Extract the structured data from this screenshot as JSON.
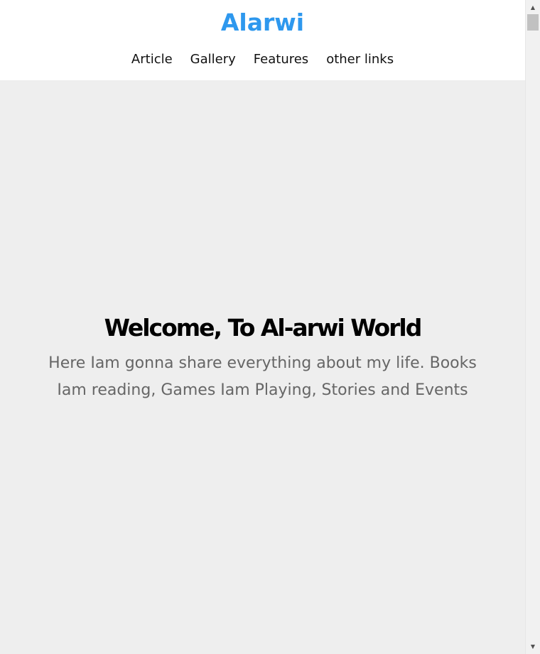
{
  "header": {
    "logo": "Alarwi",
    "nav": [
      {
        "label": "Article"
      },
      {
        "label": "Gallery"
      },
      {
        "label": "Features"
      },
      {
        "label": "other links"
      }
    ]
  },
  "hero": {
    "title": "Welcome, To Al-arwi World",
    "text": "Here Iam gonna share everything about my life. Books Iam reading, Games Iam Playing, Stories and Events"
  },
  "scrollbar": {
    "up_icon": "triangle-up-icon",
    "down_icon": "triangle-down-icon",
    "position": 0.0
  },
  "colors": {
    "brand": "#2e98ee",
    "page_background": "#eeeeee",
    "header_background": "#ffffff",
    "hero_text": "#666666"
  }
}
